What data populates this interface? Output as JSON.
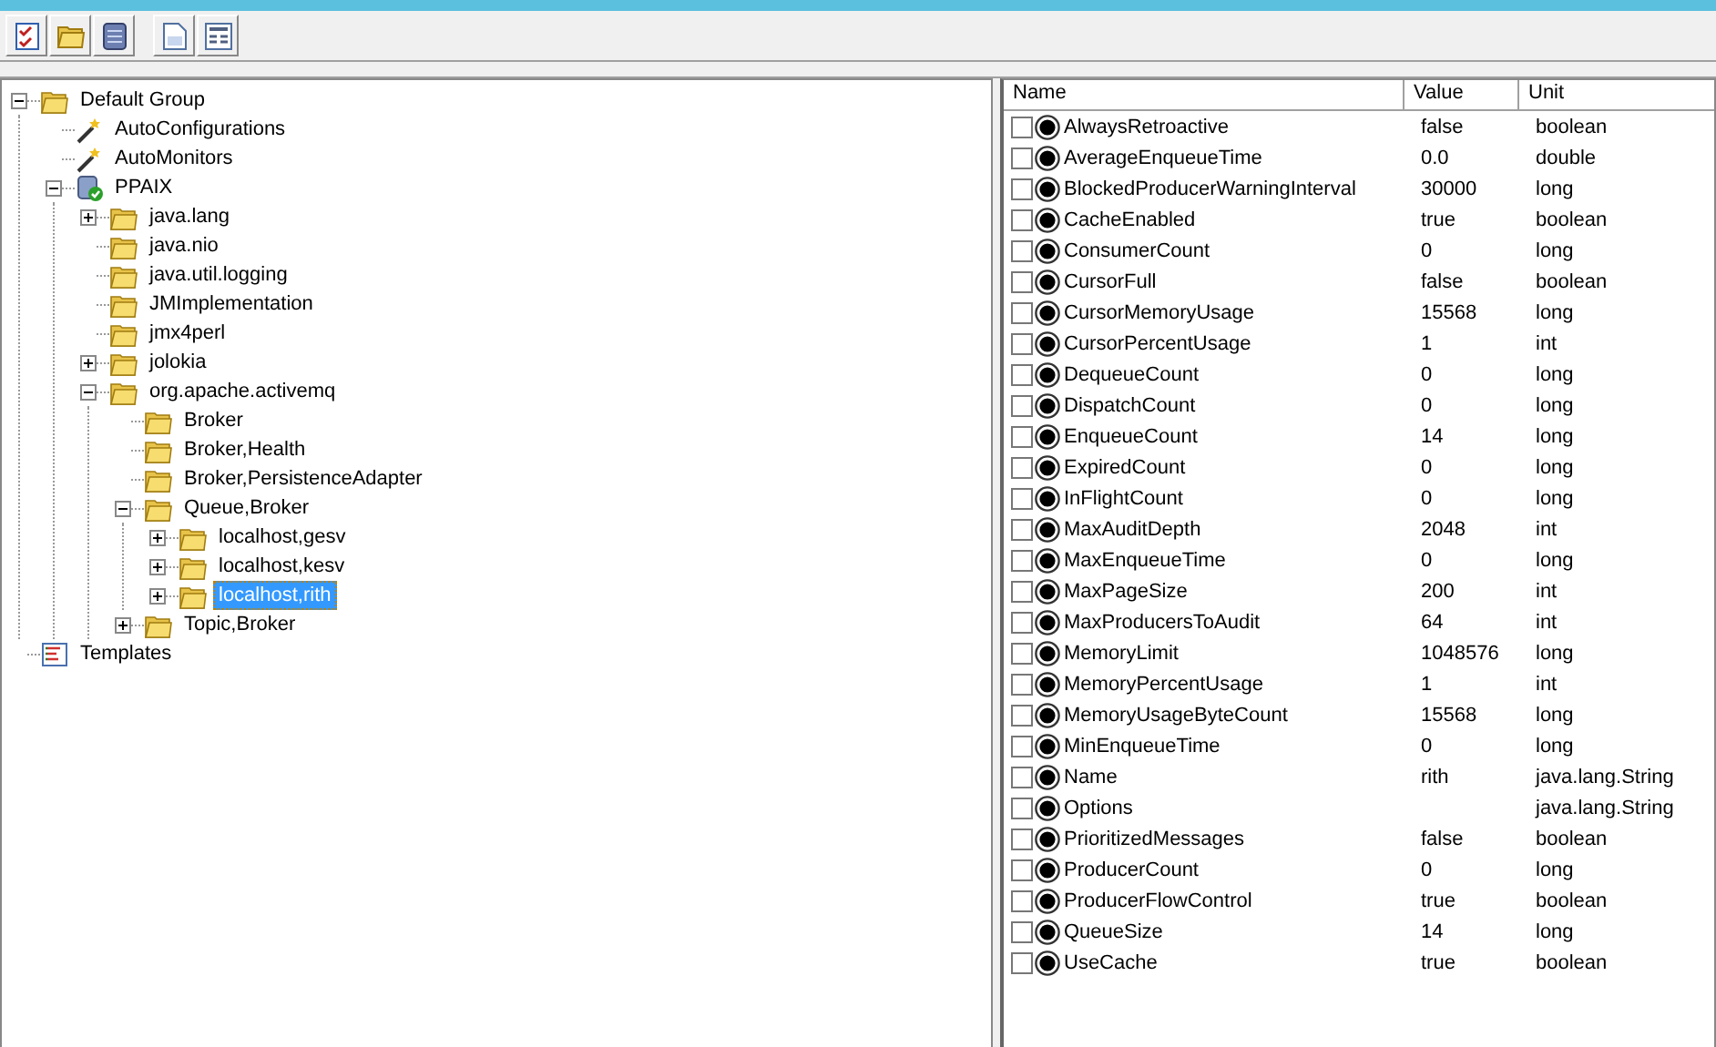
{
  "toolbar": {
    "buttons": [
      {
        "kind": "checklist"
      },
      {
        "kind": "folder"
      },
      {
        "kind": "database"
      },
      {
        "kind": "document"
      },
      {
        "kind": "form"
      }
    ]
  },
  "tree": [
    {
      "label": "Default Group",
      "kind": "folder",
      "expanded": true,
      "selected": false,
      "children": [
        {
          "label": "AutoConfigurations",
          "kind": "wand",
          "selected": false
        },
        {
          "label": "AutoMonitors",
          "kind": "wand",
          "selected": false
        },
        {
          "label": "PPAIX",
          "kind": "server",
          "expanded": true,
          "selected": false,
          "children": [
            {
              "label": "java.lang",
              "kind": "folder",
              "expanded": false,
              "selected": false
            },
            {
              "label": "java.nio",
              "kind": "folder",
              "selected": false
            },
            {
              "label": "java.util.logging",
              "kind": "folder",
              "selected": false
            },
            {
              "label": "JMImplementation",
              "kind": "folder",
              "selected": false
            },
            {
              "label": "jmx4perl",
              "kind": "folder",
              "selected": false
            },
            {
              "label": "jolokia",
              "kind": "folder",
              "expanded": false,
              "selected": false
            },
            {
              "label": "org.apache.activemq",
              "kind": "folder",
              "expanded": true,
              "selected": false,
              "children": [
                {
                  "label": "Broker",
                  "kind": "folder",
                  "selected": false
                },
                {
                  "label": "Broker,Health",
                  "kind": "folder",
                  "selected": false
                },
                {
                  "label": "Broker,PersistenceAdapter",
                  "kind": "folder",
                  "selected": false
                },
                {
                  "label": "Queue,Broker",
                  "kind": "folder",
                  "expanded": true,
                  "selected": false,
                  "children": [
                    {
                      "label": "localhost,gesv",
                      "kind": "folder",
                      "expanded": false,
                      "selected": false
                    },
                    {
                      "label": "localhost,kesv",
                      "kind": "folder",
                      "expanded": false,
                      "selected": false
                    },
                    {
                      "label": "localhost,rith",
                      "kind": "folder",
                      "expanded": false,
                      "selected": true
                    }
                  ]
                },
                {
                  "label": "Topic,Broker",
                  "kind": "folder",
                  "expanded": false,
                  "selected": false
                }
              ]
            }
          ]
        }
      ]
    },
    {
      "label": "Templates",
      "kind": "templates",
      "selected": false
    }
  ],
  "table": {
    "columns": [
      "Name",
      "Value",
      "Unit"
    ],
    "rows": [
      {
        "name": "AlwaysRetroactive",
        "value": "false",
        "unit": "boolean",
        "checked": false
      },
      {
        "name": "AverageEnqueueTime",
        "value": "0.0",
        "unit": "double",
        "checked": false
      },
      {
        "name": "BlockedProducerWarningInterval",
        "value": "30000",
        "unit": "long",
        "checked": false
      },
      {
        "name": "CacheEnabled",
        "value": "true",
        "unit": "boolean",
        "checked": false
      },
      {
        "name": "ConsumerCount",
        "value": "0",
        "unit": "long",
        "checked": false
      },
      {
        "name": "CursorFull",
        "value": "false",
        "unit": "boolean",
        "checked": false
      },
      {
        "name": "CursorMemoryUsage",
        "value": "15568",
        "unit": "long",
        "checked": false
      },
      {
        "name": "CursorPercentUsage",
        "value": "1",
        "unit": "int",
        "checked": false
      },
      {
        "name": "DequeueCount",
        "value": "0",
        "unit": "long",
        "checked": false
      },
      {
        "name": "DispatchCount",
        "value": "0",
        "unit": "long",
        "checked": false
      },
      {
        "name": "EnqueueCount",
        "value": "14",
        "unit": "long",
        "checked": false
      },
      {
        "name": "ExpiredCount",
        "value": "0",
        "unit": "long",
        "checked": false
      },
      {
        "name": "InFlightCount",
        "value": "0",
        "unit": "long",
        "checked": false
      },
      {
        "name": "MaxAuditDepth",
        "value": "2048",
        "unit": "int",
        "checked": false
      },
      {
        "name": "MaxEnqueueTime",
        "value": "0",
        "unit": "long",
        "checked": false
      },
      {
        "name": "MaxPageSize",
        "value": "200",
        "unit": "int",
        "checked": false
      },
      {
        "name": "MaxProducersToAudit",
        "value": "64",
        "unit": "int",
        "checked": false
      },
      {
        "name": "MemoryLimit",
        "value": "1048576",
        "unit": "long",
        "checked": false
      },
      {
        "name": "MemoryPercentUsage",
        "value": "1",
        "unit": "int",
        "checked": false
      },
      {
        "name": "MemoryUsageByteCount",
        "value": "15568",
        "unit": "long",
        "checked": false
      },
      {
        "name": "MinEnqueueTime",
        "value": "0",
        "unit": "long",
        "checked": false
      },
      {
        "name": "Name",
        "value": "rith",
        "unit": "java.lang.String",
        "checked": false
      },
      {
        "name": "Options",
        "unit": "java.lang.String",
        "checked": false
      },
      {
        "name": "PrioritizedMessages",
        "value": "false",
        "unit": "boolean",
        "checked": false
      },
      {
        "name": "ProducerCount",
        "value": "0",
        "unit": "long",
        "checked": false
      },
      {
        "name": "ProducerFlowControl",
        "value": "true",
        "unit": "boolean",
        "checked": false
      },
      {
        "name": "QueueSize",
        "value": "14",
        "unit": "long",
        "checked": false
      },
      {
        "name": "UseCache",
        "value": "true",
        "unit": "boolean",
        "checked": false
      }
    ]
  }
}
